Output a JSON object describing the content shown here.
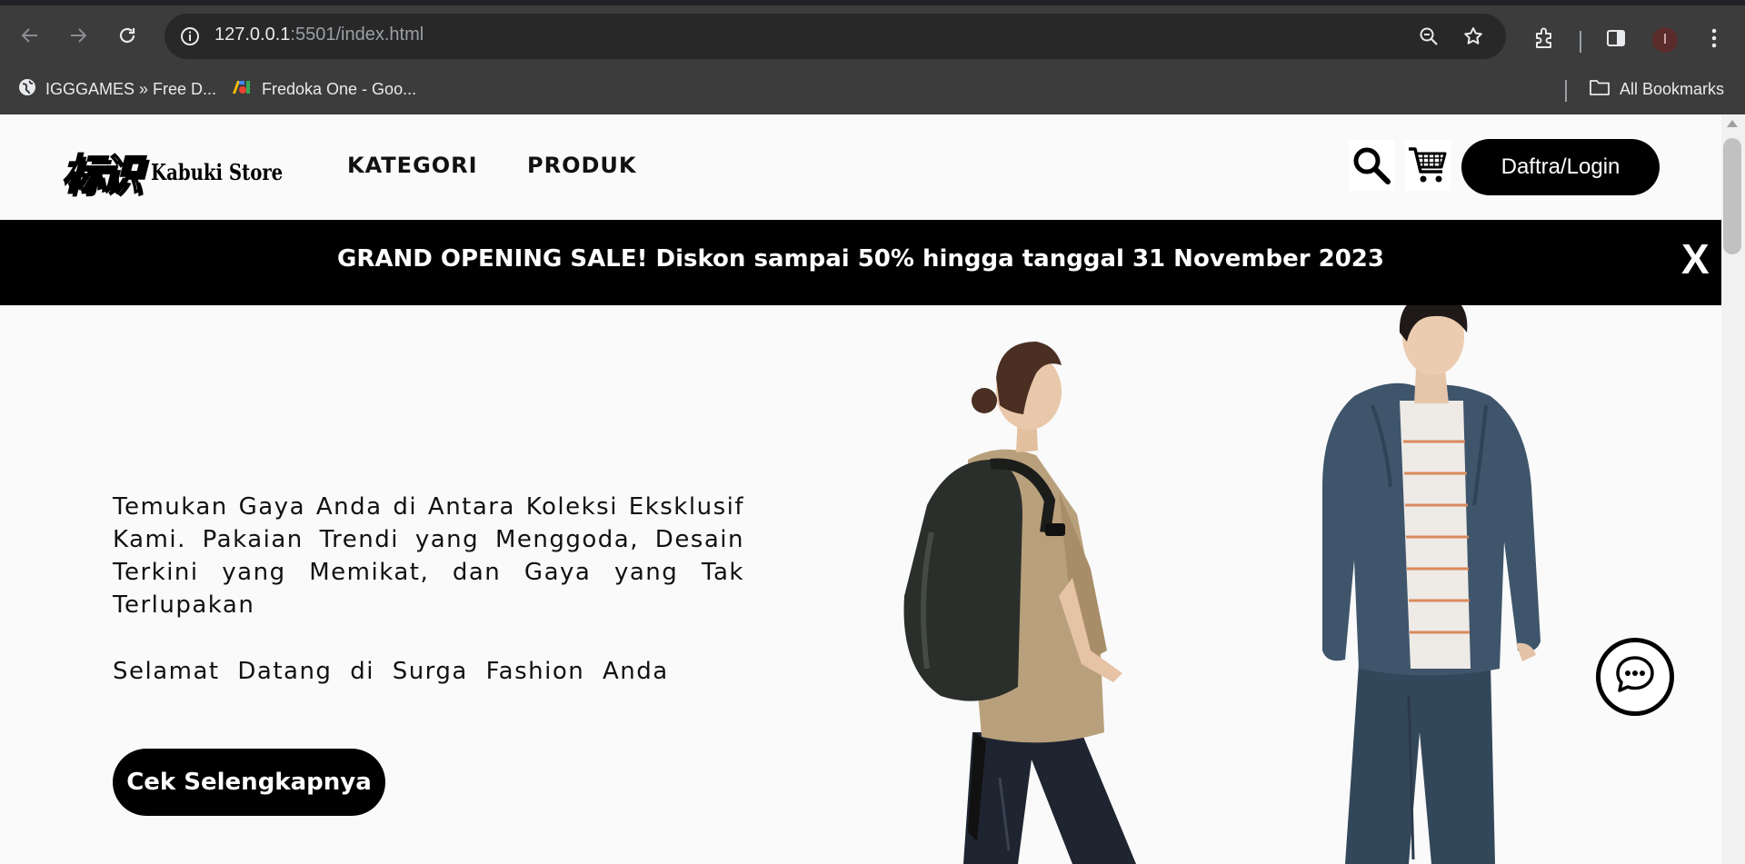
{
  "browser": {
    "url_host": "127.0.0.1",
    "url_rest": ":5501/index.html",
    "profile_initial": "I",
    "bookmarks": [
      {
        "label": "IGGGAMES » Free D..."
      },
      {
        "label": "Fredoka One - Goo..."
      }
    ],
    "all_bookmarks_label": "All Bookmarks"
  },
  "header": {
    "logo_kanji": "标识",
    "logo_name": "Kabuki Store",
    "nav": [
      {
        "label": "KATEGORI"
      },
      {
        "label": "PRODUK"
      }
    ],
    "login_label": "Daftra/Login"
  },
  "banner": {
    "text": "GRAND OPENING SALE! Diskon sampai 50% hingga tanggal 31 November 2023",
    "close_label": "X"
  },
  "hero": {
    "description": "Temukan Gaya Anda di Antara Koleksi Eksklusif Kami. Pakaian Trendi yang Menggoda, Desain Terkini yang Memikat, dan Gaya yang Tak Terlupakan",
    "welcome": "Selamat Datang di Surga Fashion Anda",
    "cta_label": "Cek Selengkapnya"
  }
}
